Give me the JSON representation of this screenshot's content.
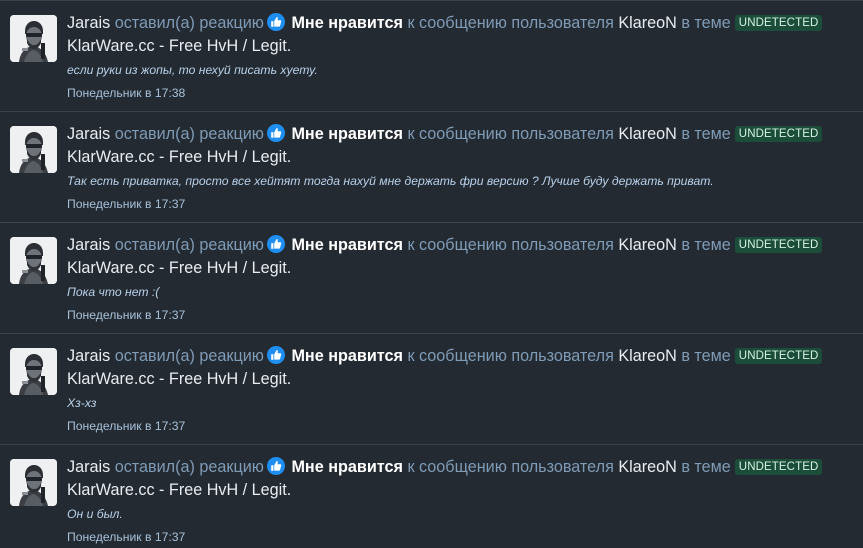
{
  "feed": {
    "items": [
      {
        "user": "Jarais",
        "action": "оставил(а) реакцию",
        "reaction": "Мне нравится",
        "to_message": "к сообщению пользователя",
        "target_user": "KlareoN",
        "in_thread": "в теме",
        "badge": "UNDETECTED",
        "thread_title": "KlarWare.cc - Free HvH / Legit.",
        "snippet": "если руки из жопы, то нехуй писать хуету.",
        "time": "Понедельник в 17:38",
        "avatar_icon": "soldier-avatar",
        "reaction_icon": "thumbs-up-icon"
      },
      {
        "user": "Jarais",
        "action": "оставил(а) реакцию",
        "reaction": "Мне нравится",
        "to_message": "к сообщению пользователя",
        "target_user": "KlareoN",
        "in_thread": "в теме",
        "badge": "UNDETECTED",
        "thread_title": "KlarWare.cc - Free HvH / Legit.",
        "snippet": "Так есть приватка, просто все хейтят тогда нахуй мне держать фри версию ? Лучше буду держать приват.",
        "time": "Понедельник в 17:37",
        "avatar_icon": "soldier-avatar",
        "reaction_icon": "thumbs-up-icon"
      },
      {
        "user": "Jarais",
        "action": "оставил(а) реакцию",
        "reaction": "Мне нравится",
        "to_message": "к сообщению пользователя",
        "target_user": "KlareoN",
        "in_thread": "в теме",
        "badge": "UNDETECTED",
        "thread_title": "KlarWare.cc - Free HvH / Legit.",
        "snippet": "Пока что нет :(",
        "time": "Понедельник в 17:37",
        "avatar_icon": "soldier-avatar",
        "reaction_icon": "thumbs-up-icon"
      },
      {
        "user": "Jarais",
        "action": "оставил(а) реакцию",
        "reaction": "Мне нравится",
        "to_message": "к сообщению пользователя",
        "target_user": "KlareoN",
        "in_thread": "в теме",
        "badge": "UNDETECTED",
        "thread_title": "KlarWare.cc - Free HvH / Legit.",
        "snippet": "Хз-хз",
        "time": "Понедельник в 17:37",
        "avatar_icon": "soldier-avatar",
        "reaction_icon": "thumbs-up-icon"
      },
      {
        "user": "Jarais",
        "action": "оставил(а) реакцию",
        "reaction": "Мне нравится",
        "to_message": "к сообщению пользователя",
        "target_user": "KlareoN",
        "in_thread": "в теме",
        "badge": "UNDETECTED",
        "thread_title": "KlarWare.cc - Free HvH / Legit.",
        "snippet": "Он и был.",
        "time": "Понедельник в 17:37",
        "avatar_icon": "soldier-avatar",
        "reaction_icon": "thumbs-up-icon"
      }
    ]
  },
  "colors": {
    "background": "#242a31",
    "separator": "#3a414a",
    "link_muted": "#7f9bb6",
    "text": "#e9edf2",
    "badge_bg": "#1c4d3a",
    "badge_text": "#d5f2e2",
    "reaction_blue": "#1f8ef1"
  }
}
